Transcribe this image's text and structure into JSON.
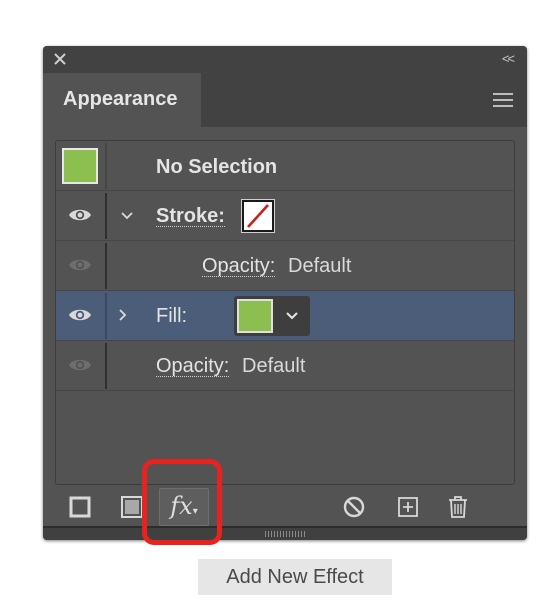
{
  "panel": {
    "tab_title": "Appearance",
    "collapse_glyph": "<<",
    "close_icon": "close-icon",
    "menu_icon": "hamburger-menu-icon"
  },
  "rows": [
    {
      "type": "selection",
      "label": "No Selection",
      "swatch_color": "#8cbf4f"
    },
    {
      "type": "stroke",
      "label": "Stroke:",
      "expanded": true,
      "swatch": "none-red-slash"
    },
    {
      "type": "opacity",
      "label": "Opacity:",
      "value": "Default",
      "indent": true
    },
    {
      "type": "fill",
      "label": "Fill:",
      "expanded": false,
      "swatch_color": "#8cbf4f",
      "selected": true
    },
    {
      "type": "opacity",
      "label": "Opacity:",
      "value": "Default",
      "indent": false
    }
  ],
  "toolbar": {
    "fx_label": "fx",
    "fx_caret": "▾",
    "icons": [
      "add-new-stroke-icon",
      "add-new-fill-icon",
      "fx-icon",
      "clear-appearance-icon",
      "duplicate-item-icon",
      "delete-icon"
    ]
  },
  "tooltip": {
    "text": "Add New Effect"
  },
  "colors": {
    "panel_bg": "#535353",
    "selected_row": "#4b5d78",
    "swatch_green": "#8cbf4f",
    "highlight_red": "#e8231d",
    "none_slash": "#c8201f"
  }
}
